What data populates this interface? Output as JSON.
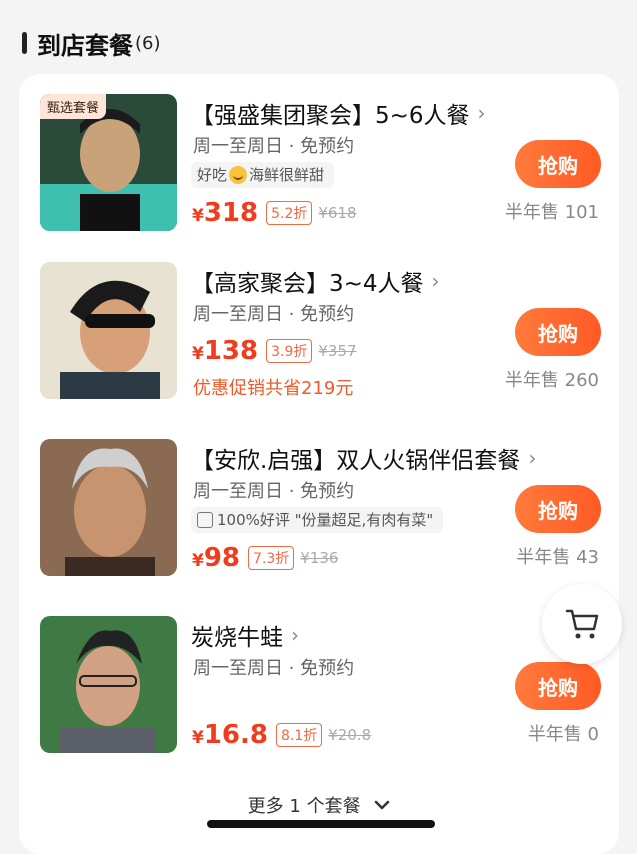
{
  "section": {
    "title": "到店套餐",
    "count": "(6)"
  },
  "items": [
    {
      "badge": "甄选套餐",
      "title": "【强盛集团聚会】5~6人餐",
      "availability": "周一至周日 · 免预约",
      "review_pre": "好吃",
      "review_post": "海鲜很鲜甜",
      "yen": "¥",
      "price": "318",
      "discount": "5.2折",
      "original": "¥618",
      "buy": "抢购",
      "sold": "半年售 101"
    },
    {
      "title": "【高家聚会】3~4人餐",
      "availability": "周一至周日 · 免预约",
      "yen": "¥",
      "price": "138",
      "discount": "3.9折",
      "original": "¥357",
      "promo": "优惠促销共省219元",
      "buy": "抢购",
      "sold": "半年售 260"
    },
    {
      "title": "【安欣.启强】双人火锅伴侣套餐",
      "availability": "周一至周日 · 免预约",
      "review": "100%好评 \"份量超足,有肉有菜\"",
      "yen": "¥",
      "price": "98",
      "discount": "7.3折",
      "original": "¥136",
      "buy": "抢购",
      "sold": "半年售 43"
    },
    {
      "title": "炭烧牛蛙",
      "availability": "周一至周日 · 免预约",
      "yen": "¥",
      "price": "16.8",
      "discount": "8.1折",
      "original": "¥20.8",
      "buy": "抢购",
      "sold": "半年售 0"
    }
  ],
  "more": {
    "label": "更多 1 个套餐"
  },
  "icons": {
    "chevron": "chevron-right-icon",
    "cart": "cart-icon",
    "expand": "chevron-down-icon"
  },
  "colors": {
    "accent": "#f03b1e",
    "button": "#ff6a2c"
  }
}
